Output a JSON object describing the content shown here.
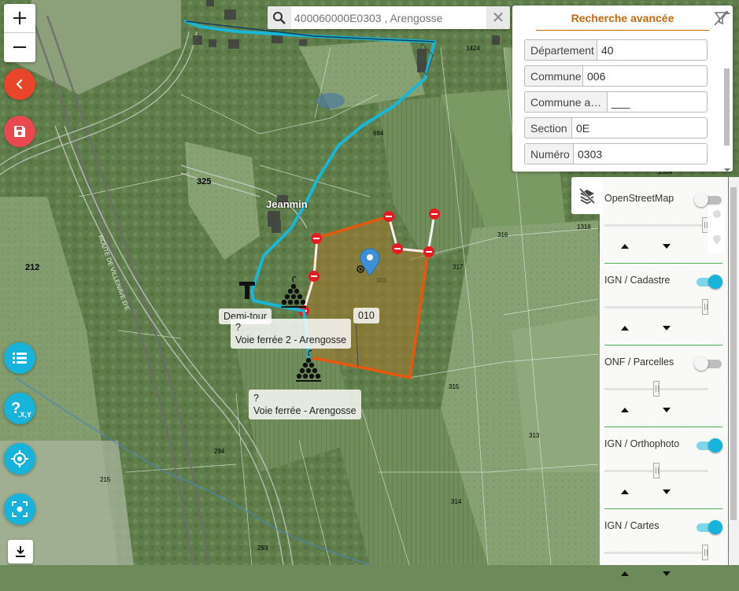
{
  "search": {
    "placeholder": "400060000E0303 , Arengosse",
    "clear_label": "✕"
  },
  "zoom": {
    "in_label": "+",
    "out_label": "−"
  },
  "advanced_search": {
    "title": "Recherche avancée",
    "fields": [
      {
        "label": "Département",
        "value": "40"
      },
      {
        "label": "Commune",
        "value": "006"
      },
      {
        "label": "Commune a…",
        "value": "___"
      },
      {
        "label": "Section",
        "value": "0E"
      },
      {
        "label": "Numéro",
        "value": "0303"
      }
    ]
  },
  "layers": [
    {
      "name": "OpenStreetMap",
      "enabled": false,
      "opacity": 1.0
    },
    {
      "name": "IGN / Cadastre",
      "enabled": true,
      "opacity": 1.0
    },
    {
      "name": "ONF / Parcelles",
      "enabled": false,
      "opacity": 0.5
    },
    {
      "name": "IGN / Orthophoto",
      "enabled": true,
      "opacity": 0.5
    },
    {
      "name": "IGN / Cartes",
      "enabled": true,
      "opacity": 1.0
    }
  ],
  "map": {
    "labels": {
      "demi_tour": "Demi-tour",
      "parcel_010": "010",
      "poi1_line1": "?",
      "poi1_line2": "Voie ferrée 2 - Arengosse",
      "poi2_line1": "?",
      "poi2_line2": "Voie ferrée - Arengosse",
      "place_name": "Jeanmin",
      "road_name": "ROUTE DE VILLENAVE D'E"
    },
    "parcel_numbers": [
      "325",
      "212",
      "684",
      "316",
      "317",
      "315",
      "313",
      "314",
      "294",
      "215",
      "293",
      "303",
      "1316",
      "1324",
      "1424"
    ]
  },
  "colors": {
    "accent": "#17b3da",
    "title_orange": "#c8690e",
    "parcel_outline": "#e8570e",
    "route": "#19b6d6",
    "red_button": "#e8452a",
    "marker_blue": "#3d8fd6"
  },
  "icons": {
    "back": "chevron-left-icon",
    "save": "floppy-disk-icon",
    "list": "list-icon",
    "coords": "question-xy-icon",
    "locate": "crosshair-icon",
    "focus": "focus-frame-icon",
    "download": "download-icon",
    "layers": "layers-off-icon",
    "filter": "filter-off-icon"
  }
}
